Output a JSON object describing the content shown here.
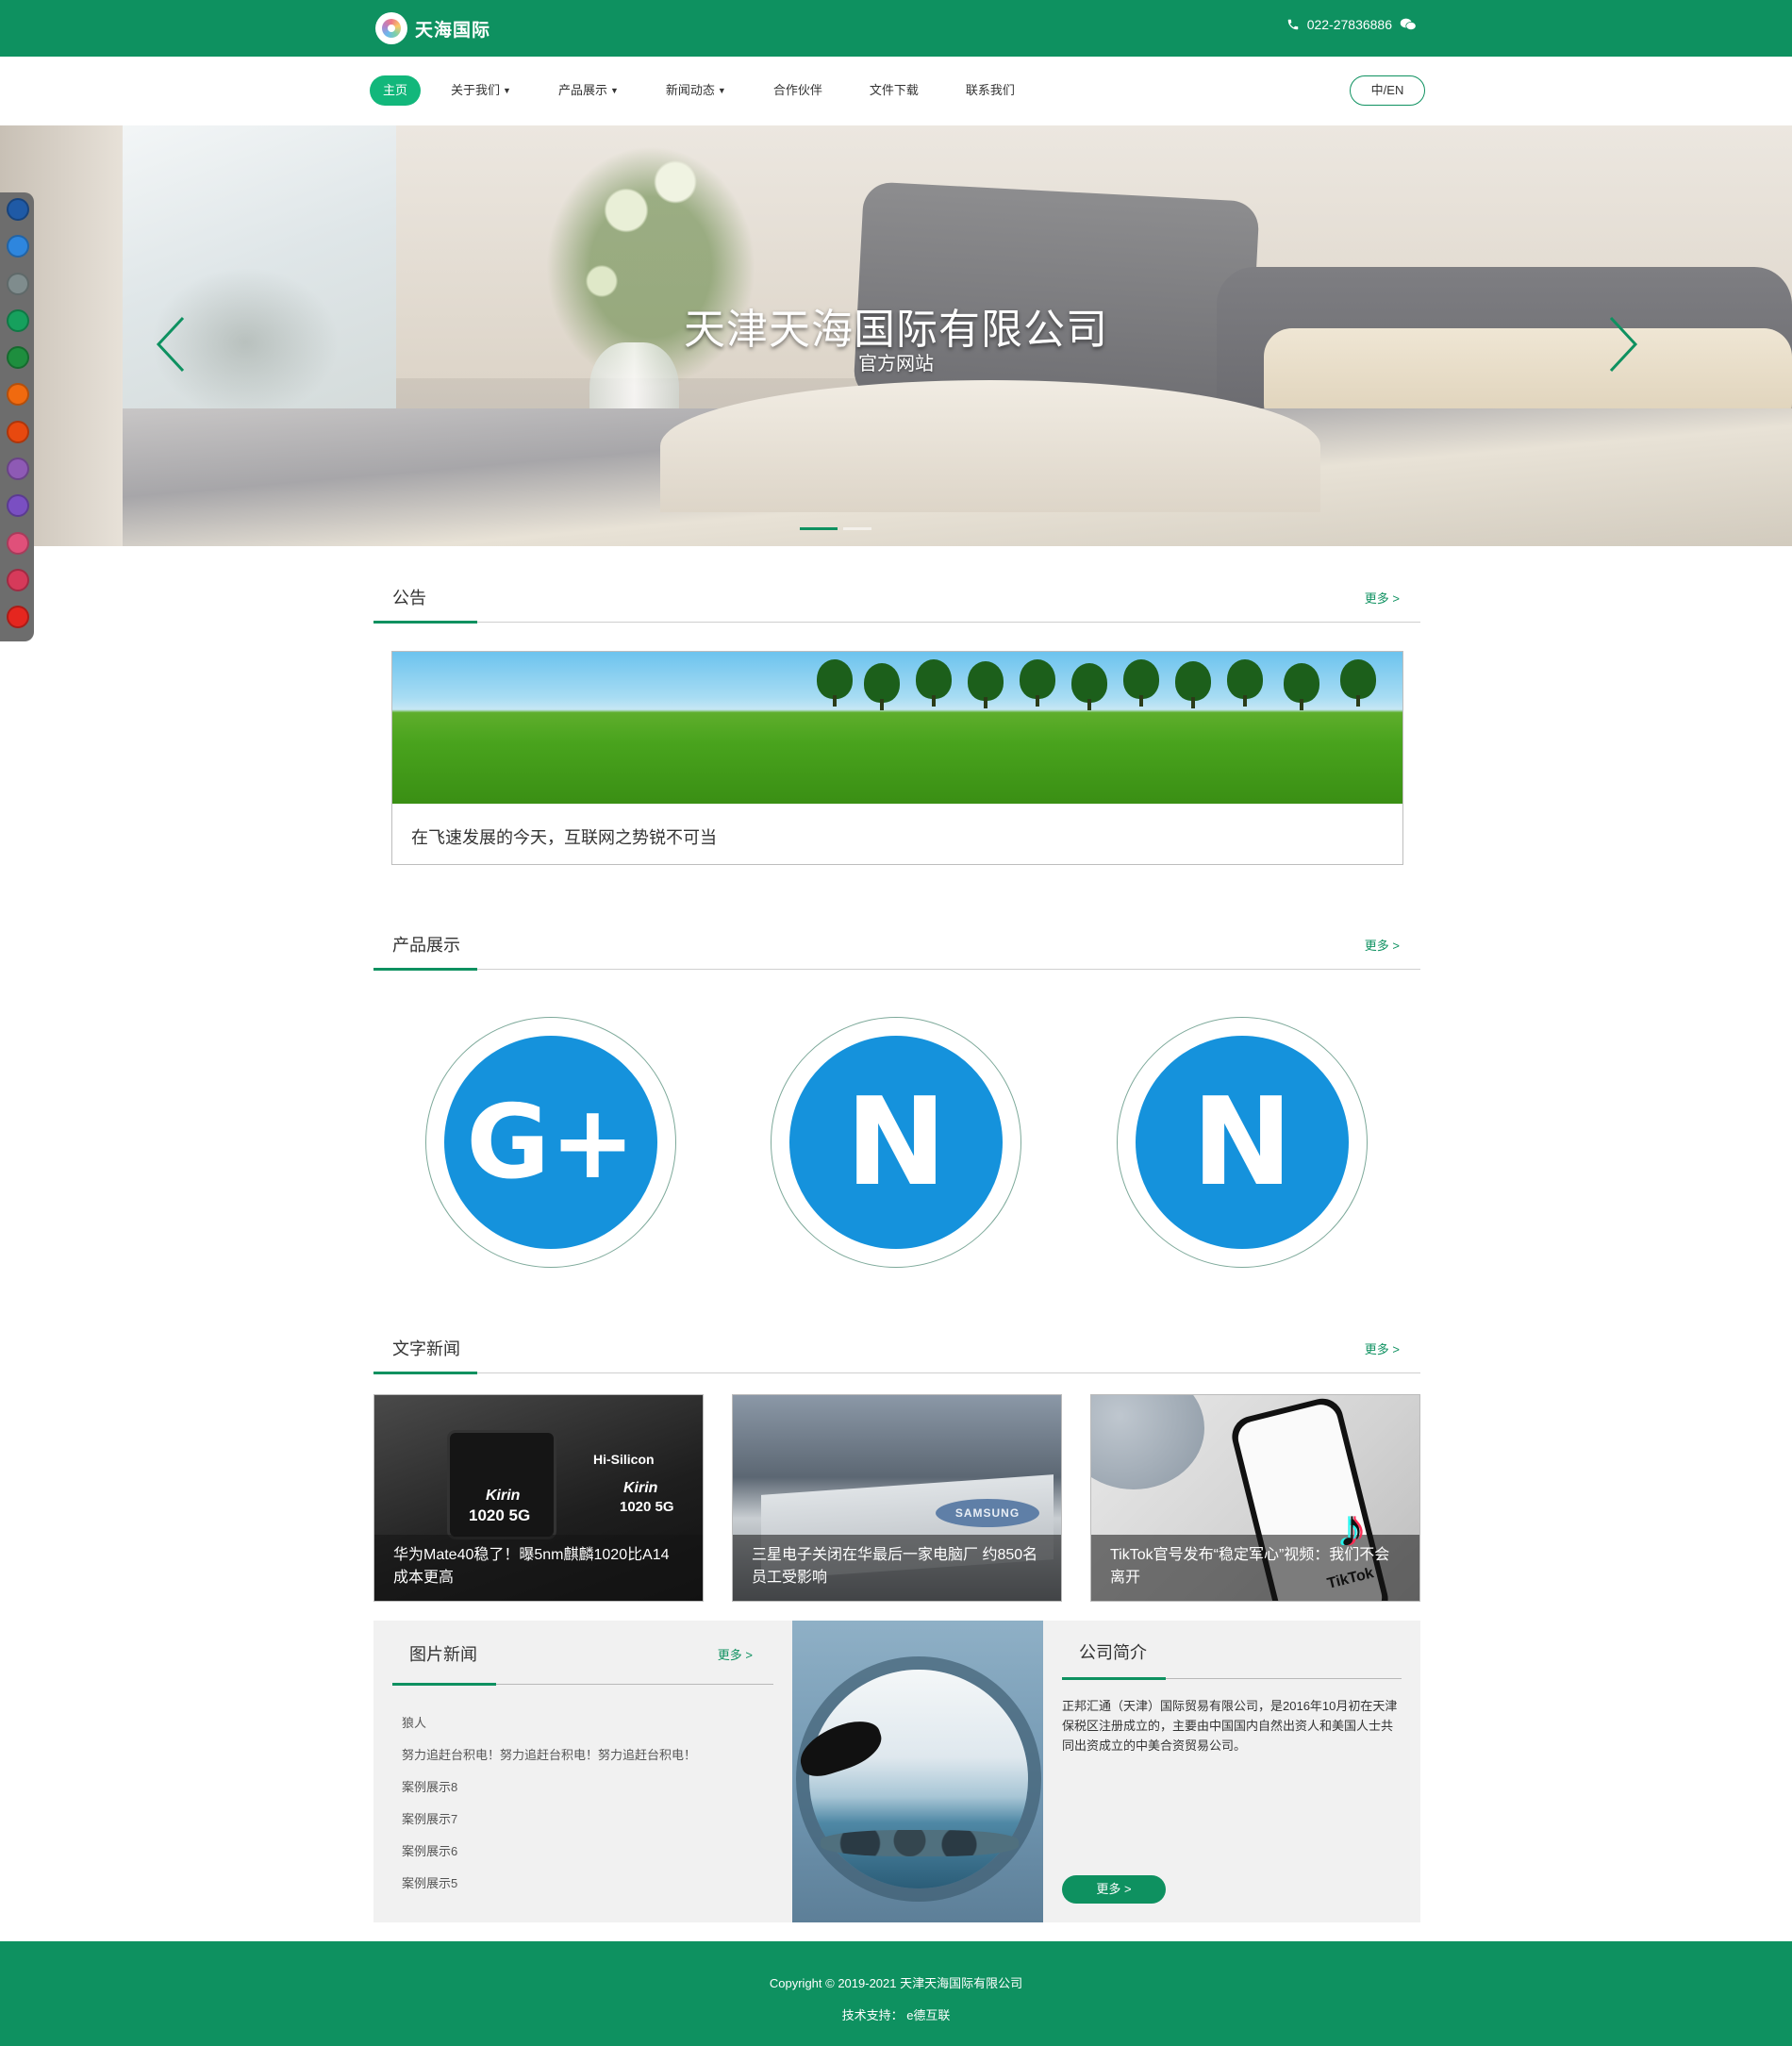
{
  "header": {
    "brand": "天海国际",
    "phone": "022-27836886",
    "icons": [
      "phone-icon",
      "wechat-icon"
    ]
  },
  "nav": {
    "items": [
      {
        "label": "主页",
        "active": true
      },
      {
        "label": "关于我们",
        "dropdown": true
      },
      {
        "label": "产品展示",
        "dropdown": true
      },
      {
        "label": "新闻动态",
        "dropdown": true
      },
      {
        "label": "合作伙伴"
      },
      {
        "label": "文件下载"
      },
      {
        "label": "联系我们"
      }
    ],
    "lang": "中/EN"
  },
  "banner": {
    "title": "天津天海国际有限公司",
    "subtitle": "官方网站",
    "prev_icon": "chevron-left-icon",
    "next_icon": "chevron-right-icon"
  },
  "theme_swatches": [
    "#1f5aa6",
    "#2e86de",
    "#7f8c8d",
    "#16a05d",
    "#1e8e3e",
    "#f06a0f",
    "#e8490f",
    "#8e5ab5",
    "#7a4fc2",
    "#e0507a",
    "#d63a5a",
    "#e5261f"
  ],
  "colors": {
    "primary": "#0e9160",
    "nav_active": "#12b77b",
    "product_blue": "#1592dc"
  },
  "notice": {
    "title": "公告",
    "more": "更多 >",
    "text": "在飞速发展的今天，互联网之势锐不可当"
  },
  "products": {
    "title": "产品展示",
    "more": "更多 >",
    "items": [
      {
        "glyph": "G+"
      },
      {
        "glyph": "N"
      },
      {
        "glyph": "N"
      }
    ]
  },
  "text_news": {
    "title": "文字新闻",
    "more": "更多 >",
    "items": [
      {
        "caption": "华为Mate40稳了！曝5nm麒麟1020比A14成本更高",
        "image_text": [
          "Hi-Silicon",
          "Kirin",
          "1020 5G",
          "Kirin",
          "1020 5G"
        ]
      },
      {
        "caption": "三星电子关闭在华最后一家电脑厂 约850名员工受影响",
        "image_text": [
          "SAMSUNG"
        ]
      },
      {
        "caption": "TikTok官号发布“稳定军心”视频：我们不会离开",
        "image_text": [
          "TikTok"
        ]
      }
    ]
  },
  "pic_news": {
    "title": "图片新闻",
    "more": "更多 >",
    "items": [
      "狼人",
      "努力追赶台积电！努力追赶台积电！努力追赶台积电！",
      "案例展示8",
      "案例展示7",
      "案例展示6",
      "案例展示5"
    ]
  },
  "about": {
    "title": "公司简介",
    "desc": "正邦汇通（天津）国际贸易有限公司，是2016年10月初在天津保税区注册成立的，主要由中国国内自然出资人和美国人士共同出资成立的中美合资贸易公司。",
    "button": "更多 >"
  },
  "footer": {
    "copyright": "Copyright © 2019-2021 天津天海国际有限公司",
    "support": "技术支持： e德互联"
  }
}
